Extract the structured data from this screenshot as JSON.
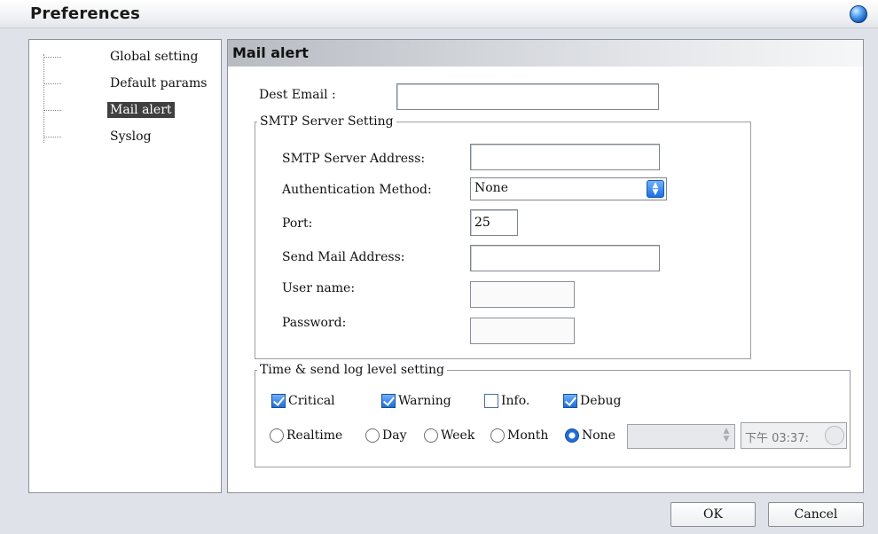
{
  "window": {
    "title": "Preferences"
  },
  "tree": {
    "items": [
      {
        "label": "Global setting",
        "selected": false
      },
      {
        "label": "Default params",
        "selected": false
      },
      {
        "label": "Mail alert",
        "selected": true
      },
      {
        "label": "Syslog",
        "selected": false
      }
    ]
  },
  "mail_alert": {
    "header": "Mail alert",
    "dest_email": {
      "label": "Dest Email :",
      "value": ""
    },
    "smtp": {
      "legend": "SMTP Server Setting",
      "server_address": {
        "label": "SMTP Server Address:",
        "value": ""
      },
      "auth_method": {
        "label": "Authentication Method:",
        "value": "None"
      },
      "port": {
        "label": "Port:",
        "value": "25"
      },
      "send_mail_address": {
        "label": "Send Mail Address:",
        "value": ""
      },
      "user_name": {
        "label": "User name:",
        "value": ""
      },
      "password": {
        "label": "Password:",
        "value": ""
      }
    },
    "log_level": {
      "legend": "Time & send log level setting",
      "levels": [
        {
          "label": "Critical",
          "checked": true
        },
        {
          "label": "Warning",
          "checked": true
        },
        {
          "label": "Info.",
          "checked": false
        },
        {
          "label": "Debug",
          "checked": true
        }
      ],
      "schedules": [
        {
          "label": "Realtime",
          "selected": false
        },
        {
          "label": "Day",
          "selected": false
        },
        {
          "label": "Week",
          "selected": false
        },
        {
          "label": "Month",
          "selected": false
        },
        {
          "label": "None",
          "selected": true
        }
      ],
      "time_value": "下午 03:37:"
    }
  },
  "buttons": {
    "ok": "OK",
    "cancel": "Cancel"
  },
  "colors": {
    "accent": "#1e6fd8",
    "selected_bg": "#3f3f3f"
  }
}
